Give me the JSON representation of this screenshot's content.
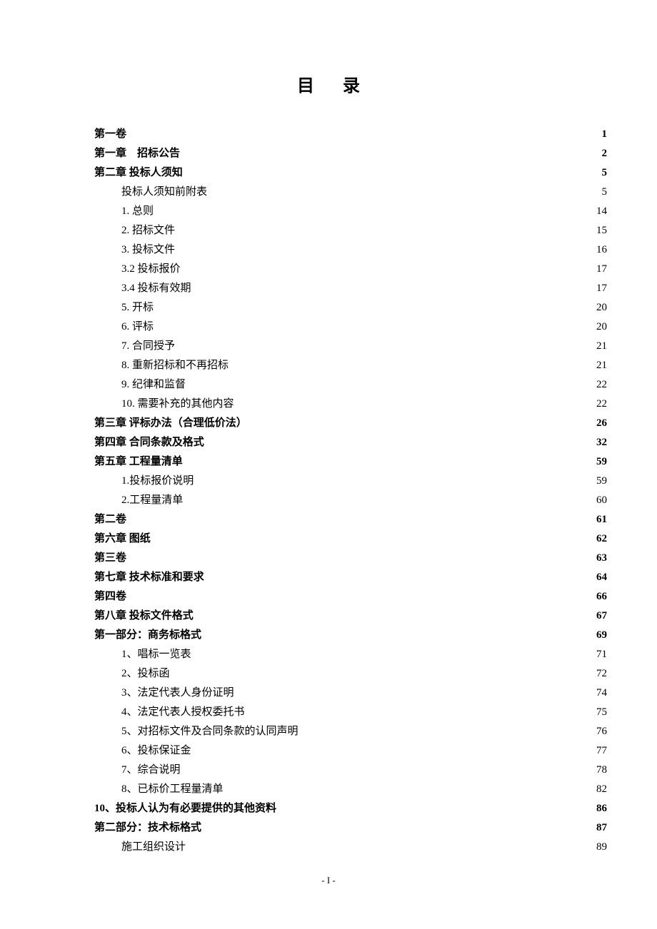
{
  "title": "目录",
  "footer": "- I -",
  "toc": [
    {
      "label": "第一卷",
      "page": "1",
      "bold": true,
      "indent": 0
    },
    {
      "label": "第一章　招标公告",
      "page": "2",
      "bold": true,
      "indent": 0
    },
    {
      "label": "第二章 投标人须知",
      "page": "5",
      "bold": true,
      "indent": 0
    },
    {
      "label": "投标人须知前附表",
      "page": "5",
      "bold": false,
      "indent": 1
    },
    {
      "label": "1. 总则",
      "page": "14",
      "bold": false,
      "indent": 1
    },
    {
      "label": "2. 招标文件",
      "page": "15",
      "bold": false,
      "indent": 1
    },
    {
      "label": "3. 投标文件",
      "page": "16",
      "bold": false,
      "indent": 1
    },
    {
      "label": "3.2 投标报价",
      "page": "17",
      "bold": false,
      "indent": 1
    },
    {
      "label": "3.4 投标有效期",
      "page": "17",
      "bold": false,
      "indent": 1
    },
    {
      "label": "5. 开标",
      "page": "20",
      "bold": false,
      "indent": 1
    },
    {
      "label": "6. 评标",
      "page": "20",
      "bold": false,
      "indent": 1
    },
    {
      "label": "7. 合同授予",
      "page": "21",
      "bold": false,
      "indent": 1
    },
    {
      "label": "8. 重新招标和不再招标",
      "page": "21",
      "bold": false,
      "indent": 1
    },
    {
      "label": "9. 纪律和监督",
      "page": "22",
      "bold": false,
      "indent": 1
    },
    {
      "label": "10. 需要补充的其他内容",
      "page": "22",
      "bold": false,
      "indent": 1
    },
    {
      "label": "第三章 评标办法（合理低价法）",
      "page": "26",
      "bold": true,
      "indent": 0
    },
    {
      "label": "第四章 合同条款及格式",
      "page": "32",
      "bold": true,
      "indent": 0
    },
    {
      "label": "第五章 工程量清单",
      "page": "59",
      "bold": true,
      "indent": 0
    },
    {
      "label": "1.投标报价说明",
      "page": "59",
      "bold": false,
      "indent": 1
    },
    {
      "label": "2.工程量清单",
      "page": "60",
      "bold": false,
      "indent": 1
    },
    {
      "label": "第二卷",
      "page": "61",
      "bold": true,
      "indent": 0
    },
    {
      "label": "第六章 图纸",
      "page": "62",
      "bold": true,
      "indent": 0
    },
    {
      "label": "第三卷",
      "page": "63",
      "bold": true,
      "indent": 0
    },
    {
      "label": "第七章 技术标准和要求",
      "page": "64",
      "bold": true,
      "indent": 0
    },
    {
      "label": "第四卷",
      "page": "66",
      "bold": true,
      "indent": 0
    },
    {
      "label": "第八章 投标文件格式",
      "page": "67",
      "bold": true,
      "indent": 0
    },
    {
      "label": "第一部分：商务标格式",
      "page": "69",
      "bold": true,
      "indent": 0
    },
    {
      "label": "1、唱标一览表",
      "page": "71",
      "bold": false,
      "indent": 1
    },
    {
      "label": "2、投标函",
      "page": "72",
      "bold": false,
      "indent": 1
    },
    {
      "label": "3、法定代表人身份证明",
      "page": "74",
      "bold": false,
      "indent": 1
    },
    {
      "label": "4、法定代表人授权委托书",
      "page": "75",
      "bold": false,
      "indent": 1
    },
    {
      "label": "5、对招标文件及合同条款的认同声明",
      "page": "76",
      "bold": false,
      "indent": 1
    },
    {
      "label": "6、投标保证金",
      "page": "77",
      "bold": false,
      "indent": 1
    },
    {
      "label": "7、综合说明",
      "page": "78",
      "bold": false,
      "indent": 1
    },
    {
      "label": "8、已标价工程量清单",
      "page": "82",
      "bold": false,
      "indent": 1
    },
    {
      "label": "10、投标人认为有必要提供的其他资料",
      "page": "86",
      "bold": true,
      "indent": 0
    },
    {
      "label": "第二部分：技术标格式",
      "page": "87",
      "bold": true,
      "indent": 0
    },
    {
      "label": "施工组织设计",
      "page": "89",
      "bold": false,
      "indent": 1
    }
  ]
}
